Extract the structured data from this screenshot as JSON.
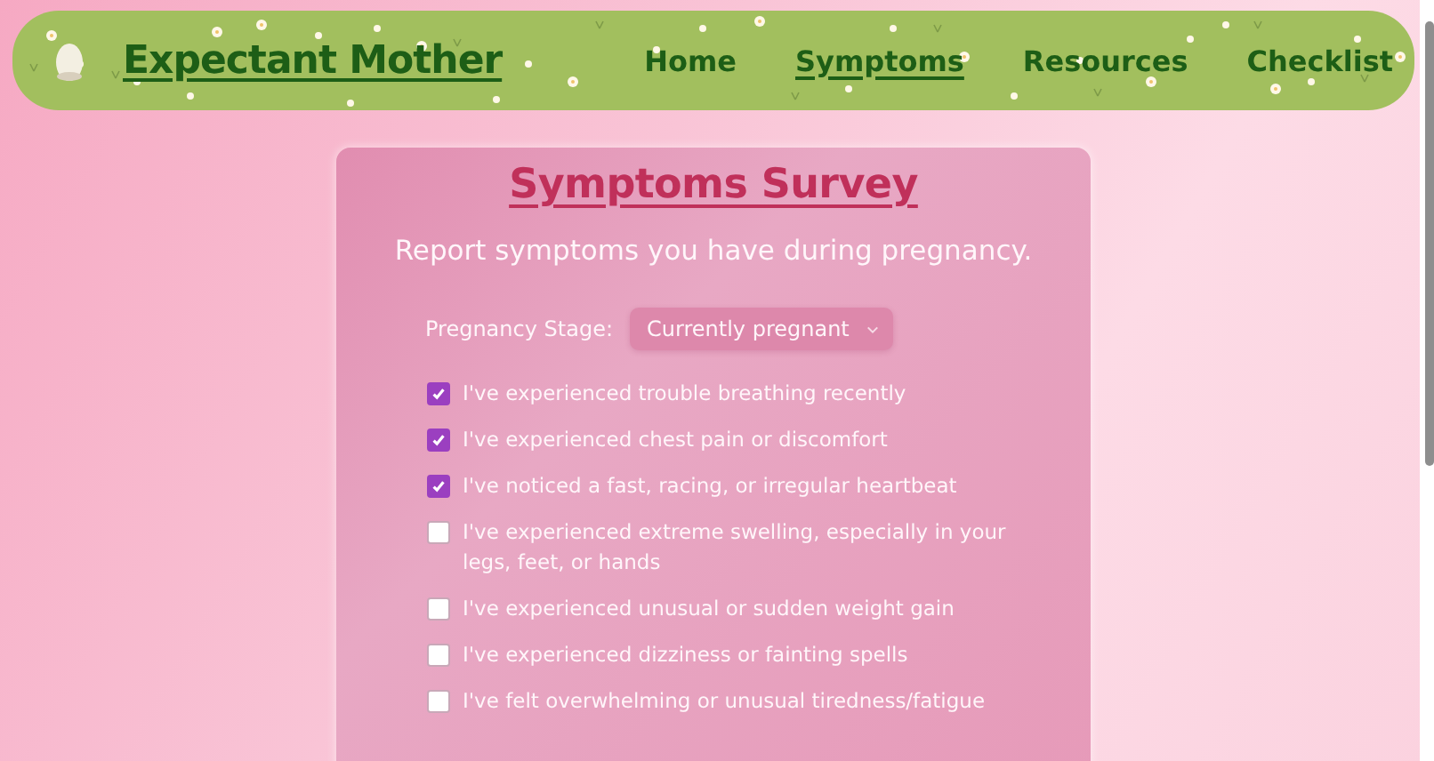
{
  "header": {
    "logo": "Expectant Mother",
    "nav": [
      {
        "label": "Home",
        "selected": false
      },
      {
        "label": "Symptoms",
        "selected": true
      },
      {
        "label": "Resources",
        "selected": false
      },
      {
        "label": "Checklist",
        "selected": false
      }
    ]
  },
  "survey": {
    "title": "Symptoms Survey",
    "subtitle": "Report symptoms you have during pregnancy.",
    "stage": {
      "label": "Pregnancy Stage:",
      "value": "Currently pregnant"
    },
    "symptoms": [
      {
        "label": "I've experienced trouble breathing recently",
        "checked": true
      },
      {
        "label": "I've experienced chest pain or discomfort",
        "checked": true
      },
      {
        "label": "I've noticed a fast, racing, or irregular heartbeat",
        "checked": true
      },
      {
        "label": "I've experienced extreme swelling, especially in your legs, feet, or hands",
        "checked": false
      },
      {
        "label": "I've experienced unusual or sudden weight gain",
        "checked": false
      },
      {
        "label": "I've experienced dizziness or fainting spells",
        "checked": false
      },
      {
        "label": "I've felt overwhelming or unusual tiredness/fatigue",
        "checked": false
      }
    ]
  }
}
